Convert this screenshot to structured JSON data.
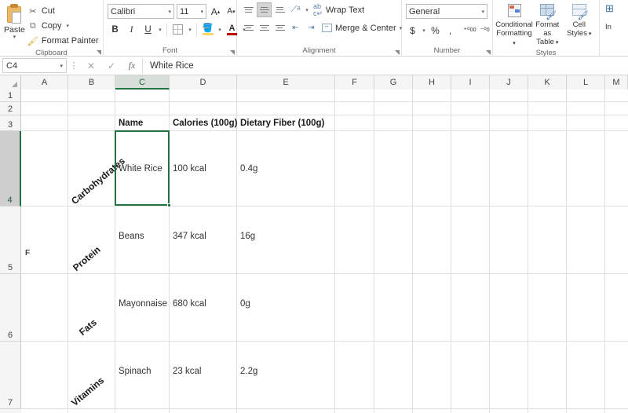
{
  "ribbon": {
    "groups": [
      {
        "name": "Clipboard",
        "label": "Clipboard",
        "paste_label": "Paste",
        "commands": [
          {
            "label": "Cut",
            "icon": "scissors-icon",
            "has_dropdown": false
          },
          {
            "label": "Copy",
            "icon": "copy-icon",
            "has_dropdown": true
          },
          {
            "label": "Format Painter",
            "icon": "format-painter-icon",
            "has_dropdown": false
          }
        ]
      },
      {
        "name": "Font",
        "label": "Font",
        "font_name": "Calibri",
        "font_size": "11",
        "grow_font": "A",
        "shrink_font": "A",
        "bold": "B",
        "italic": "I",
        "underline": "U"
      },
      {
        "name": "Alignment",
        "label": "Alignment",
        "wrap_text": "Wrap Text",
        "merge_center": "Merge & Center"
      },
      {
        "name": "Number",
        "label": "Number",
        "format": "General",
        "currency": "$",
        "percent": "%",
        "comma": ",",
        "increase_decimal": "00",
        "decrease_decimal": "00"
      },
      {
        "name": "Styles",
        "label": "Styles",
        "items": [
          {
            "line1": "Conditional",
            "line2": "Formatting"
          },
          {
            "line1": "Format as",
            "line2": "Table"
          },
          {
            "line1": "Cell",
            "line2": "Styles"
          }
        ]
      },
      {
        "name": "Insert",
        "label": "In"
      }
    ]
  },
  "formula_bar": {
    "name_box": "C4",
    "cancel_icon": "x-icon",
    "confirm_icon": "check-icon",
    "function_icon": "fx-icon",
    "value": "White Rice"
  },
  "sheet": {
    "columns": [
      "A",
      "B",
      "C",
      "D",
      "E",
      "F",
      "G",
      "H",
      "I",
      "J",
      "K",
      "L",
      "M"
    ],
    "selected_column": "C",
    "rows": [
      "1",
      "2",
      "3",
      "4",
      "5",
      "6",
      "7"
    ],
    "selected_row": "4",
    "selection": "C4",
    "header_row": {
      "name": "Name",
      "calories": "Calories (100g)",
      "fiber": "Dietary Fiber (100g)"
    },
    "stray_cell_a5": "F",
    "categories": [
      {
        "label": "Carbohydrates",
        "name": "White Rice",
        "calories": "100 kcal",
        "fiber": "0.4g"
      },
      {
        "label": "Protein",
        "name": "Beans",
        "calories": "347 kcal",
        "fiber": "16g"
      },
      {
        "label": "Fats",
        "name": "Mayonnaise",
        "calories": "680 kcal",
        "fiber": "0g"
      },
      {
        "label": "Vitamins",
        "name": "Spinach",
        "calories": "23 kcal",
        "fiber": "2.2g"
      }
    ]
  },
  "colors": {
    "excel_green": "#217346",
    "header_bg": "#f5f5f5",
    "grid_line": "#e0e0e0"
  }
}
